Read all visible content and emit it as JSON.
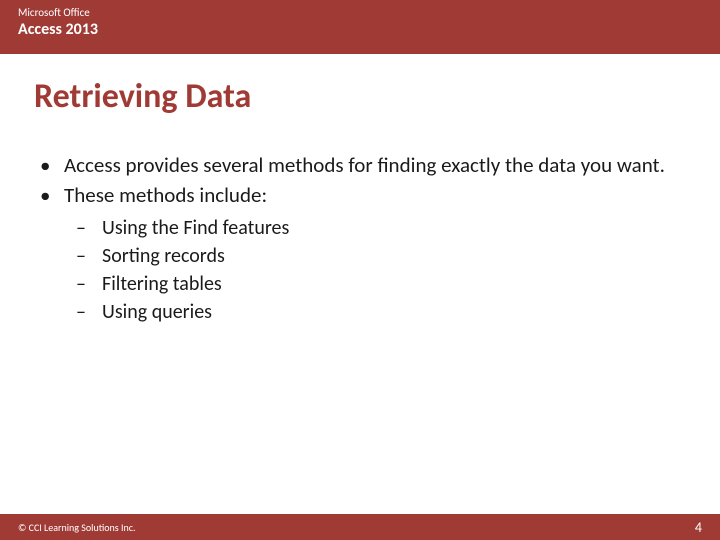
{
  "header": {
    "brand": "Microsoft Office",
    "product": "Access 2013"
  },
  "title": "Retrieving Data",
  "bullets": [
    {
      "marker": "•",
      "text": "Access provides several methods for finding exactly the data you want."
    },
    {
      "marker": "•",
      "text": "These methods include:"
    }
  ],
  "subbullets": [
    {
      "marker": "–",
      "text": "Using the Find features"
    },
    {
      "marker": "–",
      "text": "Sorting records"
    },
    {
      "marker": "–",
      "text": "Filtering tables"
    },
    {
      "marker": "–",
      "text": "Using queries"
    }
  ],
  "footer": {
    "copyright": "© CCI Learning Solutions Inc.",
    "page_number": "4"
  }
}
